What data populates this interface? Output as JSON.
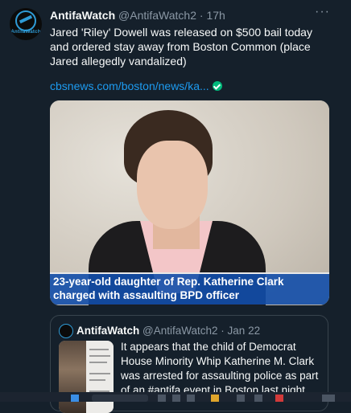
{
  "tweet": {
    "avatar_text": "AntifaWatch",
    "name": "AntifaWatch",
    "handle": "@AntifaWatch2",
    "separator": "·",
    "time": "17h",
    "more_icon": "more-icon",
    "text": "Jared 'Riley' Dowell  was released on $500 bail today and ordered stay away from Boston Common (place Jared allegedly vandalized)",
    "link_text": "cbsnews.com/boston/news/ka...",
    "media_caption_line1": "23-year-old daughter of Rep. Katherine Clark",
    "media_caption_line2": "charged with assaulting BPD officer"
  },
  "quote": {
    "name": "AntifaWatch",
    "handle": "@AntifaWatch2",
    "separator": "·",
    "time": "Jan 22",
    "text": "It appears that the child of Democrat House Minority Whip Katherine M. Clark was arrested for assaulting police as part of an #antifa event in Boston last night."
  },
  "colors": {
    "background": "#15202b",
    "link": "#1d9bf0",
    "secondary_text": "#8b98a5",
    "caption_bar": "#124eaa",
    "verified": "#00ba7c"
  }
}
